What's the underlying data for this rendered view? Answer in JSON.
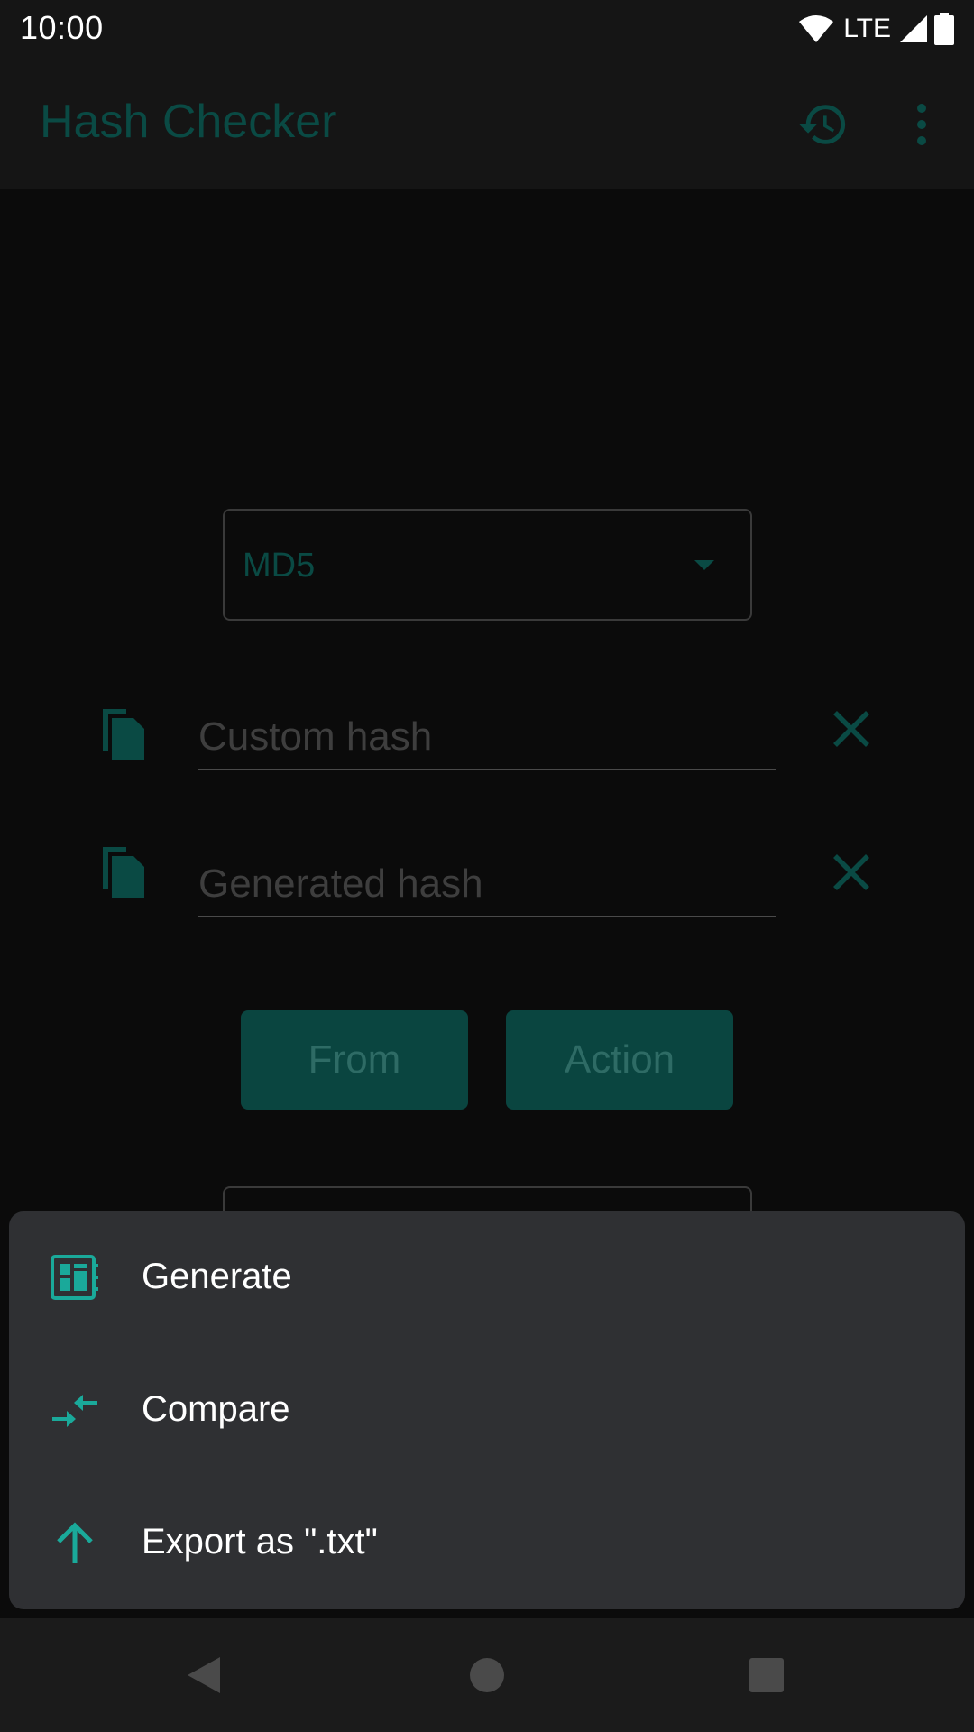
{
  "status_bar": {
    "time": "10:00",
    "network": "LTE",
    "icons": [
      "wifi-icon",
      "signal-icon",
      "battery-icon"
    ]
  },
  "app_bar": {
    "title": "Hash Checker",
    "actions": [
      "history-icon",
      "more-vert-icon"
    ]
  },
  "main": {
    "hash_type": {
      "selected": "MD5"
    },
    "custom_hash": {
      "placeholder": "Custom hash",
      "value": ""
    },
    "generated_hash": {
      "placeholder": "Generated hash",
      "value": ""
    },
    "buttons": {
      "from": "From",
      "action": "Action"
    }
  },
  "bottom_sheet": {
    "items": [
      {
        "label": "Generate",
        "icon": "generate-icon"
      },
      {
        "label": "Compare",
        "icon": "compare-icon"
      },
      {
        "label": "Export as \".txt\"",
        "icon": "arrow-up-icon"
      }
    ]
  },
  "navigation": {
    "buttons": [
      "back-icon",
      "home-icon",
      "recents-icon"
    ]
  },
  "colors": {
    "accent": "#1aa99a",
    "dim_accent": "#0a4a44",
    "sheet_background": "#2f3033",
    "background": "#0b0b0b"
  }
}
